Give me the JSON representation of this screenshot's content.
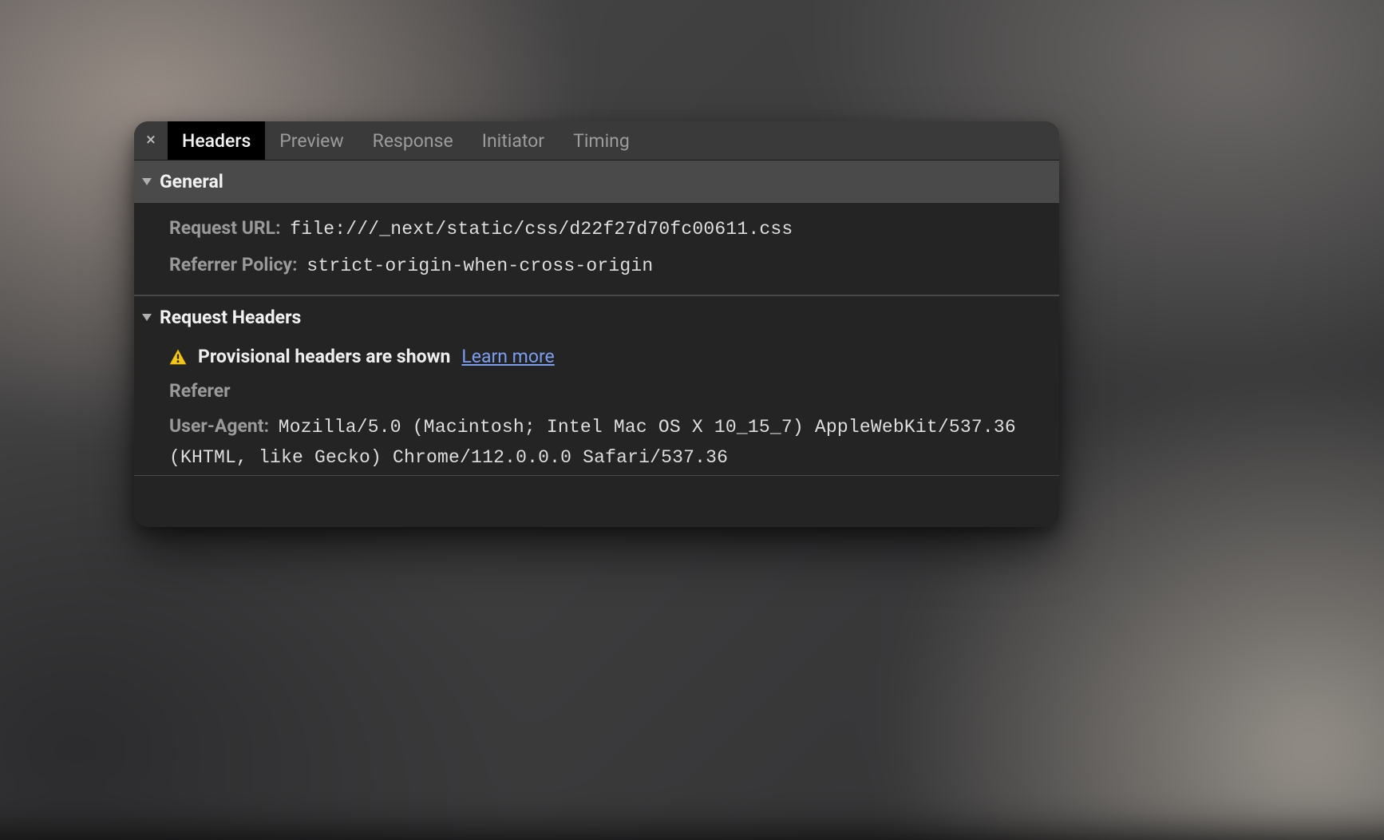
{
  "tabs": {
    "close_glyph": "×",
    "items": [
      {
        "label": "Headers",
        "active": true
      },
      {
        "label": "Preview",
        "active": false
      },
      {
        "label": "Response",
        "active": false
      },
      {
        "label": "Initiator",
        "active": false
      },
      {
        "label": "Timing",
        "active": false
      }
    ]
  },
  "sections": {
    "general": {
      "title": "General",
      "request_url": {
        "label": "Request URL:",
        "value": "file:///_next/static/css/d22f27d70fc00611.css"
      },
      "referrer_policy": {
        "label": "Referrer Policy:",
        "value": "strict-origin-when-cross-origin"
      }
    },
    "request_headers": {
      "title": "Request Headers",
      "notice": "Provisional headers are shown",
      "learn_more": "Learn more",
      "referer": {
        "label": "Referer",
        "value": ""
      },
      "user_agent": {
        "label": "User-Agent:",
        "value": "Mozilla/5.0 (Macintosh; Intel Mac OS X 10_15_7) AppleWebKit/537.36 (KHTML, like Gecko) Chrome/112.0.0.0 Safari/537.36"
      }
    }
  }
}
